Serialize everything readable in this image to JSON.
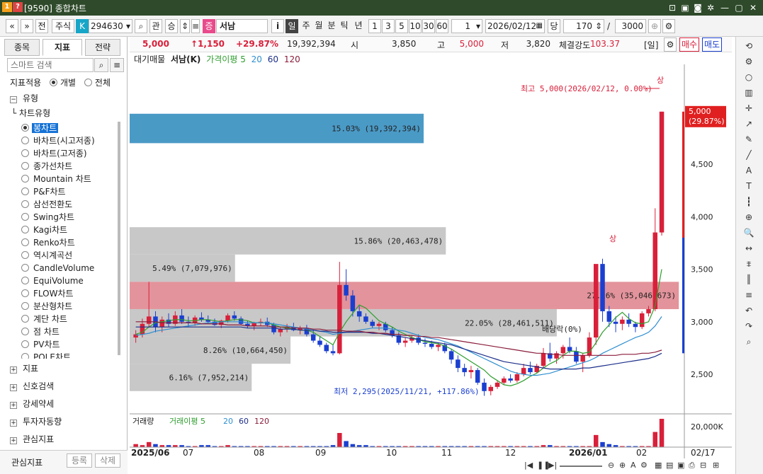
{
  "window": {
    "code": "[9590]",
    "title": "종합차트"
  },
  "toolbar": {
    "stock_type": "주식",
    "stock_code": "294630",
    "gwan": "관",
    "seung": "승",
    "jeung": "증",
    "stock_name": "서남",
    "periods": [
      "일",
      "주",
      "월",
      "분",
      "틱",
      "년"
    ],
    "active_period": "일",
    "nums": [
      "1",
      "3",
      "5",
      "10",
      "30",
      "60"
    ],
    "period_val": "1",
    "date": "2026/02/12",
    "dang": "당",
    "count": "170",
    "total": "3000",
    "jeon": "전"
  },
  "left": {
    "tabs": [
      "종목",
      "지표",
      "전략"
    ],
    "active_tab": "지표",
    "search_placeholder": "스마트 검색",
    "apply_label": "지표적용",
    "radio_each": "개별",
    "radio_all": "전체",
    "type_section": "유형",
    "chart_type_label": "차트유형",
    "chart_types": [
      "봉차트",
      "바차트(시고저종)",
      "바차트(고저종)",
      "종가선차트",
      "Mountain 차트",
      "P&F차트",
      "삼선전환도",
      "Swing차트",
      "Kagi차트",
      "Renko차트",
      "역시계곡선",
      "CandleVolume",
      "EquiVolume",
      "FLOW차트",
      "분산형차트",
      "계단 차트",
      "점 차트",
      "PV차트",
      "POLE차트"
    ],
    "selected_type": "봉차트",
    "sections": [
      "지표",
      "신호검색",
      "강세약세",
      "투자자동향",
      "관심지표"
    ],
    "favorite": "관심지표",
    "register": "등록",
    "delete": "삭제"
  },
  "price_bar": {
    "price": "5,000",
    "change": "↑1,150",
    "pct": "+29.87%",
    "volume": "19,392,394",
    "open_lbl": "시",
    "open": "3,850",
    "high_lbl": "고",
    "high": "5,000",
    "low_lbl": "저",
    "low": "3,820",
    "strength_lbl": "체결강도",
    "strength": "103.37",
    "period_lbl": "[일]",
    "buy": "매수",
    "sell": "매도"
  },
  "legend": {
    "main": "대기매물",
    "name": "서남(K)",
    "ma_label": "가격이평",
    "ma": [
      "5",
      "20",
      "60",
      "120"
    ],
    "vol_label": "거래량",
    "vol_ma_label": "거래이평"
  },
  "colors": {
    "ma5": "#2e9e2e",
    "ma20": "#2f8fd0",
    "ma60": "#1c2f8a",
    "ma120": "#8a1c3a",
    "up": "#d8203a",
    "down": "#1a3fd0"
  },
  "chart_data": {
    "type": "candlestick-volume-profile",
    "y_ticks": [
      "5,000",
      "4,500",
      "4,000",
      "3,500",
      "3,000",
      "2,500"
    ],
    "x_ticks": [
      "2025/06",
      "07",
      "08",
      "09",
      "10",
      "11",
      "12",
      "2026/01",
      "02",
      "02/17"
    ],
    "volume_profile": [
      {
        "label": "15.03% (19,392,394)",
        "low": 4700,
        "high": 4980,
        "color": "#4a9ac6"
      },
      {
        "label": "15.86% (20,463,478)",
        "low": 3640,
        "high": 3900,
        "color": "#c8c8c8"
      },
      {
        "label": "5.49% (7,079,976)",
        "low": 3380,
        "high": 3640,
        "color": "#c8c8c8"
      },
      {
        "label": "27.16% (35,046,673)",
        "low": 3120,
        "high": 3380,
        "color": "#e3939b"
      },
      {
        "label": "22.05% (28,461,511)",
        "low": 2860,
        "high": 3120,
        "color": "#c8c8c8"
      },
      {
        "label": "8.26% (10,664,450)",
        "low": 2600,
        "high": 2860,
        "color": "#c8c8c8"
      },
      {
        "label": "6.16% (7,952,214)",
        "low": 2340,
        "high": 2600,
        "color": "#c8c8c8"
      }
    ],
    "profile_widths": [
      0.53,
      0.57,
      0.19,
      0.99,
      0.77,
      0.29,
      0.22
    ],
    "annotations": {
      "high": "최고 5,000(2026/02/12, 0.00%)",
      "low": "최저 2,295(2025/11/21, +117.86%)",
      "dividend": "배당락(0%)",
      "sang": "상"
    },
    "price_label": "5,000",
    "pct_label": "(29.87%)",
    "vol_tick": "20,000K",
    "candles": [
      [
        2850,
        2920,
        2800,
        2880
      ],
      [
        2880,
        3030,
        2850,
        2980
      ],
      [
        2980,
        3380,
        2950,
        3050
      ],
      [
        3050,
        3100,
        2900,
        2950
      ],
      [
        2950,
        3050,
        2900,
        3020
      ],
      [
        3020,
        3080,
        2950,
        2980
      ],
      [
        2980,
        3100,
        2960,
        3060
      ],
      [
        3060,
        3120,
        2980,
        3000
      ],
      [
        3000,
        3050,
        2950,
        2990
      ],
      [
        2990,
        3060,
        2960,
        3040
      ],
      [
        3040,
        3090,
        3000,
        3020
      ],
      [
        3020,
        3060,
        2980,
        3000
      ],
      [
        3000,
        3030,
        2960,
        2970
      ],
      [
        2970,
        3020,
        2940,
        3010
      ],
      [
        3010,
        3080,
        2990,
        3060
      ],
      [
        3060,
        3100,
        3010,
        3030
      ],
      [
        3030,
        3050,
        2970,
        2980
      ],
      [
        2980,
        3010,
        2940,
        2960
      ],
      [
        2960,
        3000,
        2920,
        2990
      ],
      [
        2990,
        3030,
        2960,
        3000
      ],
      [
        3000,
        3040,
        2950,
        2970
      ],
      [
        2970,
        2990,
        2880,
        2900
      ],
      [
        2900,
        2950,
        2860,
        2930
      ],
      [
        2930,
        2980,
        2900,
        2950
      ],
      [
        2950,
        2990,
        2910,
        2920
      ],
      [
        2920,
        2960,
        2880,
        2940
      ],
      [
        2940,
        2970,
        2860,
        2880
      ],
      [
        2880,
        2920,
        2800,
        2820
      ],
      [
        2820,
        2860,
        2760,
        2780
      ],
      [
        2780,
        2800,
        2700,
        2720
      ],
      [
        2720,
        2780,
        2680,
        2700
      ],
      [
        2700,
        3570,
        2690,
        3350
      ],
      [
        3350,
        3500,
        3200,
        3250
      ],
      [
        3250,
        3300,
        3050,
        3100
      ],
      [
        3100,
        3150,
        3000,
        3050
      ],
      [
        3050,
        3080,
        2980,
        3000
      ],
      [
        3000,
        3020,
        2940,
        2960
      ],
      [
        2960,
        3000,
        2920,
        2980
      ],
      [
        2980,
        3000,
        2900,
        2920
      ],
      [
        2920,
        2950,
        2850,
        2870
      ],
      [
        2870,
        2900,
        2780,
        2800
      ],
      [
        2800,
        2850,
        2760,
        2820
      ],
      [
        2820,
        2870,
        2800,
        2850
      ],
      [
        2850,
        2880,
        2780,
        2800
      ],
      [
        2800,
        2840,
        2760,
        2790
      ],
      [
        2790,
        2820,
        2740,
        2760
      ],
      [
        2760,
        2800,
        2720,
        2780
      ],
      [
        2780,
        2800,
        2700,
        2720
      ],
      [
        2720,
        2740,
        2600,
        2640
      ],
      [
        2640,
        2680,
        2520,
        2560
      ],
      [
        2560,
        2600,
        2480,
        2520
      ],
      [
        2520,
        2580,
        2460,
        2540
      ],
      [
        2540,
        2560,
        2400,
        2420
      ],
      [
        2420,
        2460,
        2295,
        2340
      ],
      [
        2340,
        2400,
        2300,
        2380
      ],
      [
        2380,
        2440,
        2360,
        2420
      ],
      [
        2420,
        2480,
        2400,
        2460
      ],
      [
        2460,
        2500,
        2420,
        2440
      ],
      [
        2440,
        2520,
        2420,
        2500
      ],
      [
        2500,
        2600,
        2480,
        2560
      ],
      [
        2560,
        2620,
        2500,
        2520
      ],
      [
        2520,
        2600,
        2510,
        2580
      ],
      [
        2580,
        2750,
        2560,
        2700
      ],
      [
        2700,
        2800,
        2620,
        2650
      ],
      [
        2650,
        2720,
        2600,
        2700
      ],
      [
        2700,
        2780,
        2650,
        2760
      ],
      [
        2760,
        2850,
        2700,
        2720
      ],
      [
        2720,
        2760,
        2600,
        2620
      ],
      [
        2620,
        2700,
        2520,
        2680
      ],
      [
        2680,
        2900,
        2660,
        2850
      ],
      [
        2850,
        2960,
        2780,
        3550
      ],
      [
        3550,
        3600,
        3000,
        3100
      ],
      [
        3100,
        3150,
        2950,
        3000
      ],
      [
        3000,
        3050,
        2900,
        2980
      ],
      [
        2980,
        3050,
        2920,
        3020
      ],
      [
        3020,
        3080,
        2950,
        2980
      ],
      [
        2980,
        3000,
        2900,
        2950
      ],
      [
        2950,
        3100,
        2930,
        3080
      ],
      [
        3080,
        3150,
        3050,
        3120
      ],
      [
        3120,
        4080,
        3100,
        3850
      ],
      [
        3850,
        5000,
        3820,
        5000
      ]
    ],
    "ma_lines": {
      "ma5": [
        2880,
        2900,
        2950,
        2990,
        3000,
        3010,
        3020,
        3020,
        3010,
        3010,
        3020,
        3020,
        3010,
        3000,
        3010,
        3020,
        3020,
        3010,
        2990,
        2990,
        2990,
        2970,
        2950,
        2940,
        2930,
        2920,
        2920,
        2900,
        2860,
        2820,
        2780,
        2900,
        3000,
        3080,
        3160,
        3130,
        3070,
        3010,
        2980,
        2950,
        2910,
        2880,
        2850,
        2830,
        2810,
        2800,
        2790,
        2770,
        2740,
        2700,
        2660,
        2620,
        2580,
        2540,
        2480,
        2440,
        2400,
        2390,
        2410,
        2440,
        2480,
        2510,
        2560,
        2600,
        2630,
        2680,
        2720,
        2720,
        2700,
        2710,
        2800,
        2900,
        2970,
        3040,
        3090,
        3030,
        2990,
        2980,
        3000,
        3150,
        3500
      ],
      "ma20": [
        2870,
        2880,
        2890,
        2910,
        2920,
        2930,
        2940,
        2950,
        2960,
        2970,
        2980,
        2990,
        2990,
        3000,
        3000,
        3000,
        3000,
        2990,
        2990,
        2990,
        2990,
        2980,
        2970,
        2960,
        2950,
        2940,
        2930,
        2920,
        2910,
        2900,
        2880,
        2890,
        2900,
        2910,
        2920,
        2930,
        2940,
        2940,
        2940,
        2930,
        2920,
        2910,
        2890,
        2870,
        2850,
        2840,
        2830,
        2810,
        2790,
        2770,
        2740,
        2710,
        2680,
        2650,
        2620,
        2590,
        2560,
        2530,
        2510,
        2500,
        2490,
        2490,
        2500,
        2510,
        2530,
        2550,
        2570,
        2590,
        2610,
        2630,
        2660,
        2700,
        2730,
        2760,
        2790,
        2820,
        2850,
        2870,
        2900,
        2960,
        3050
      ],
      "ma60": [
        2950,
        2950,
        2950,
        2950,
        2950,
        2950,
        2950,
        2950,
        2950,
        2950,
        2950,
        2950,
        2950,
        2950,
        2950,
        2950,
        2950,
        2940,
        2940,
        2940,
        2940,
        2940,
        2930,
        2930,
        2930,
        2920,
        2920,
        2920,
        2910,
        2910,
        2900,
        2900,
        2900,
        2900,
        2900,
        2900,
        2890,
        2890,
        2880,
        2870,
        2860,
        2850,
        2840,
        2830,
        2820,
        2810,
        2800,
        2790,
        2780,
        2760,
        2740,
        2720,
        2700,
        2680,
        2660,
        2640,
        2620,
        2610,
        2600,
        2590,
        2580,
        2570,
        2560,
        2550,
        2550,
        2550,
        2550,
        2550,
        2560,
        2560,
        2570,
        2580,
        2590,
        2600,
        2610,
        2620,
        2630,
        2640,
        2650,
        2670,
        2700
      ],
      "ma120": [
        3000,
        3000,
        3000,
        3000,
        2990,
        2990,
        2990,
        2990,
        2990,
        2990,
        2980,
        2980,
        2980,
        2980,
        2970,
        2970,
        2970,
        2960,
        2960,
        2960,
        2960,
        2950,
        2950,
        2950,
        2940,
        2940,
        2940,
        2930,
        2930,
        2920,
        2920,
        2920,
        2910,
        2910,
        2910,
        2900,
        2900,
        2890,
        2890,
        2880,
        2880,
        2870,
        2870,
        2860,
        2860,
        2850,
        2850,
        2840,
        2830,
        2820,
        2810,
        2800,
        2790,
        2780,
        2770,
        2760,
        2750,
        2740,
        2730,
        2720,
        2710,
        2700,
        2700,
        2690,
        2690,
        2680,
        2680,
        2680,
        2680,
        2680,
        2680,
        2680,
        2680,
        2680,
        2690,
        2690,
        2690,
        2700,
        2700,
        2710,
        2730
      ]
    },
    "volumes": [
      3,
      2,
      5,
      3,
      2,
      2,
      2,
      2,
      1,
      1,
      2,
      2,
      1,
      1,
      2,
      1,
      1,
      1,
      1,
      1,
      1,
      1,
      1,
      1,
      1,
      1,
      1,
      1,
      1,
      1,
      2,
      14,
      6,
      3,
      2,
      2,
      1,
      1,
      1,
      1,
      1,
      1,
      1,
      1,
      1,
      1,
      1,
      1,
      1,
      1,
      1,
      1,
      1,
      1,
      1,
      1,
      1,
      1,
      1,
      1,
      1,
      1,
      2,
      2,
      1,
      1,
      1,
      1,
      1,
      1,
      12,
      5,
      3,
      2,
      1,
      1,
      1,
      1,
      1,
      15,
      28
    ]
  },
  "right_icons": [
    "refresh-icon",
    "gear-icon",
    "circle-icon",
    "chart-icon",
    "crosshair-icon",
    "pen-icon",
    "pencil-icon",
    "line-icon",
    "auto-icon",
    "text-icon",
    "candle-icon",
    "magnifier-icon",
    "zoom-icon",
    "ruler-icon",
    "fib-icon",
    "bars-icon",
    "lines-icon",
    "undo-icon",
    "redo-icon",
    "search-icon"
  ],
  "bottom": {
    "pager": "◁ ▷"
  }
}
